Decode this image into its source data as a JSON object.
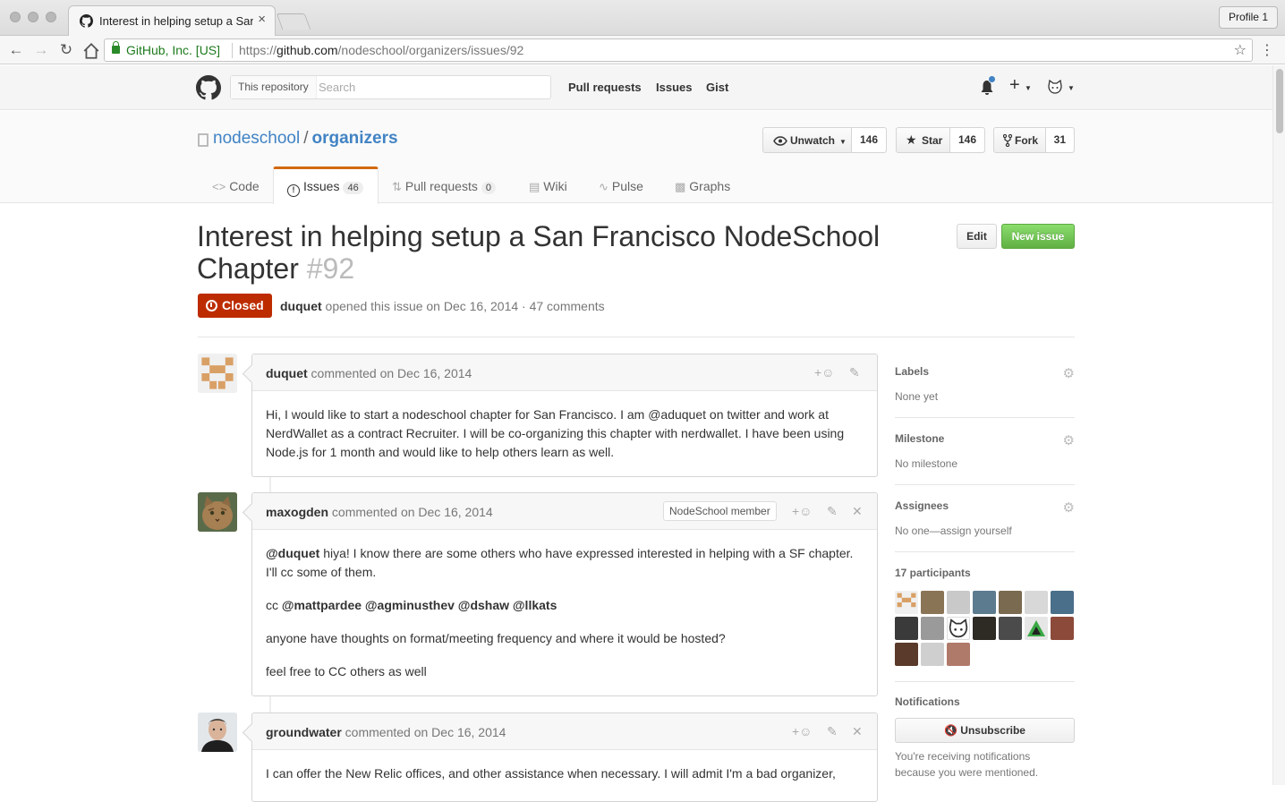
{
  "browser": {
    "tab_title": "Interest in helping setup a San Francisco NodeSchool Chapter",
    "tab_close": "×",
    "profile_label": "Profile 1",
    "security_label": "GitHub, Inc. [US]",
    "url_prefix": "https://",
    "url_host": "github.com",
    "url_path": "/nodeschool/organizers/issues/92"
  },
  "gh_header": {
    "search_scope": "This repository",
    "search_placeholder": "Search",
    "nav": [
      "Pull requests",
      "Issues",
      "Gist"
    ],
    "accent": "#4183c4"
  },
  "repo": {
    "owner": "nodeschool",
    "name": "organizers",
    "watch_label": "Unwatch",
    "watch_count": "146",
    "star_label": "Star",
    "star_count": "146",
    "fork_label": "Fork",
    "fork_count": "31",
    "tabs": [
      {
        "label": "Code",
        "icon": "code-icon"
      },
      {
        "label": "Issues",
        "icon": "issue-icon",
        "count": "46",
        "selected": true
      },
      {
        "label": "Pull requests",
        "icon": "pull-request-icon",
        "count": "0"
      },
      {
        "label": "Wiki",
        "icon": "book-icon"
      },
      {
        "label": "Pulse",
        "icon": "pulse-icon"
      },
      {
        "label": "Graphs",
        "icon": "graph-icon"
      }
    ]
  },
  "issue": {
    "title": "Interest in helping setup a San Francisco NodeSchool Chapter",
    "number": "#92",
    "edit_label": "Edit",
    "new_issue_label": "New issue",
    "state": "Closed",
    "state_color": "#bd2c00",
    "author": "duquet",
    "meta": " opened this issue on Dec 16, 2014 · 47 comments"
  },
  "comments": [
    {
      "author": "duquet",
      "action": " commented on Dec 16, 2014",
      "body": [
        "Hi, I would like to start a nodeschool chapter for San Francisco. I am @aduquet on twitter and work at NerdWallet as a contract Recruiter. I will be co-organizing this chapter with nerdwallet. I have been using Node.js for 1 month and would like to help others learn as well."
      ]
    },
    {
      "author": "maxogden",
      "action": " commented on Dec 16, 2014",
      "badge": "NodeSchool member",
      "mention": "@duquet",
      "body_first_rest": " hiya! I know there are some others who have expressed interested in helping with a SF chapter. I'll cc some of them.",
      "cc_prefix": "cc ",
      "cc_mentions": "@mattpardee @agminusthev @dshaw @llkats",
      "body_more": [
        "anyone have thoughts on format/meeting frequency and where it would be hosted?",
        "feel free to CC others as well"
      ]
    },
    {
      "author": "groundwater",
      "action": " commented on Dec 16, 2014",
      "body": [
        "I can offer the New Relic offices, and other assistance when necessary. I will admit I'm a bad organizer,"
      ]
    }
  ],
  "sidebar": {
    "labels_heading": "Labels",
    "labels_value": "None yet",
    "milestone_heading": "Milestone",
    "milestone_value": "No milestone",
    "assignees_heading": "Assignees",
    "assignees_value": "No one—assign yourself",
    "participants_heading": "17 participants",
    "notifications_heading": "Notifications",
    "unsubscribe_label": "Unsubscribe",
    "notification_reason": "You're receiving notifications because you were mentioned."
  }
}
